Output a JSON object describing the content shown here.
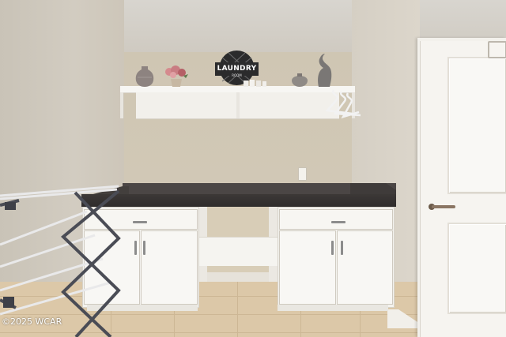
{
  "sign": {
    "main": "LAUNDRY",
    "sub": "ROOM"
  },
  "watermark": "©2025 WCAR",
  "colors": {
    "countertop": "#3c3837",
    "cabinets": "#f4f3ef",
    "wall": "#cfc6b3",
    "floor_tile": "#dcc8a8"
  },
  "icons": [
    "laundry-sign-icon",
    "vase-icon",
    "flower-pot-icon",
    "elephant-figurine-icon",
    "hanger-icon",
    "door-handle-icon",
    "drying-rack-icon"
  ]
}
